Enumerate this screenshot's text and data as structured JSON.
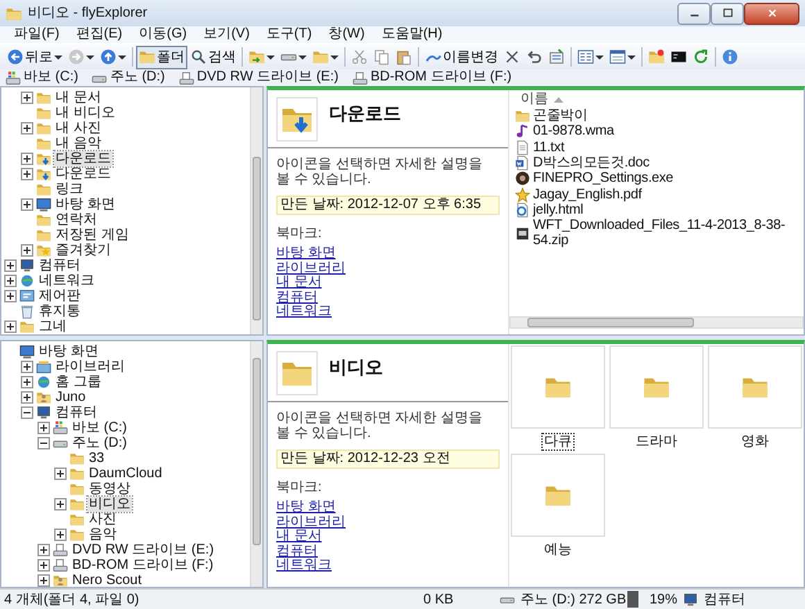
{
  "window": {
    "title": "비디오 - flyExplorer"
  },
  "menu": [
    "파일(F)",
    "편집(E)",
    "이동(G)",
    "보기(V)",
    "도구(T)",
    "창(W)",
    "도움말(H)"
  ],
  "toolbar": [
    {
      "kind": "button",
      "label": "뒤로",
      "dropdown": true,
      "pressed": false
    },
    {
      "kind": "button",
      "dropdown": true,
      "pressed": false
    },
    {
      "kind": "button",
      "dropdown": true,
      "pressed": false
    },
    {
      "kind": "separator"
    },
    {
      "kind": "button",
      "label": "폴더",
      "dropdown": false,
      "pressed": true
    },
    {
      "kind": "button",
      "label": "검색",
      "dropdown": false,
      "pressed": false
    },
    {
      "kind": "separator"
    },
    {
      "kind": "button",
      "dropdown": true,
      "pressed": false
    },
    {
      "kind": "button",
      "dropdown": true,
      "pressed": false
    },
    {
      "kind": "button",
      "dropdown": true,
      "pressed": false
    },
    {
      "kind": "separator"
    },
    {
      "kind": "button",
      "dropdown": false,
      "pressed": false
    },
    {
      "kind": "button",
      "dropdown": false,
      "pressed": false
    },
    {
      "kind": "button",
      "dropdown": false,
      "pressed": false
    },
    {
      "kind": "separator"
    },
    {
      "kind": "button",
      "label": "이름변경",
      "dropdown": false,
      "pressed": false
    },
    {
      "kind": "button",
      "dropdown": false,
      "pressed": false
    },
    {
      "kind": "button",
      "dropdown": false,
      "pressed": false
    },
    {
      "kind": "button",
      "dropdown": false,
      "pressed": false
    },
    {
      "kind": "separator"
    },
    {
      "kind": "button",
      "dropdown": true,
      "pressed": false
    },
    {
      "kind": "button",
      "dropdown": true,
      "pressed": false
    },
    {
      "kind": "separator"
    },
    {
      "kind": "button",
      "dropdown": false,
      "pressed": false
    },
    {
      "kind": "button",
      "dropdown": false,
      "pressed": false
    },
    {
      "kind": "button",
      "dropdown": false,
      "pressed": false
    },
    {
      "kind": "separator"
    },
    {
      "kind": "button",
      "dropdown": false,
      "pressed": false
    }
  ],
  "drives": [
    "바보 (C:)",
    "주노 (D:)",
    "DVD RW 드라이브 (E:)",
    "BD-ROM 드라이브 (F:)"
  ],
  "trees": [
    {
      "items": [
        {
          "children": [
            {
              "label": "내 문서",
              "expandable": true,
              "expanded": false,
              "selected": false
            },
            {
              "label": "내 비디오",
              "expandable": false,
              "selected": false
            },
            {
              "label": "내 사진",
              "expandable": true,
              "expanded": false,
              "selected": false
            },
            {
              "label": "내 음악",
              "expandable": false,
              "selected": false
            },
            {
              "label": "다운로드",
              "expandable": true,
              "expanded": false,
              "selected": true
            },
            {
              "label": "다운로드",
              "expandable": true,
              "expanded": false,
              "selected": false
            },
            {
              "label": "링크",
              "expandable": false,
              "selected": false
            },
            {
              "label": "바탕 화면",
              "expandable": true,
              "expanded": false,
              "selected": false
            },
            {
              "label": "연락처",
              "expandable": false,
              "selected": false
            },
            {
              "label": "저장된 게임",
              "expandable": false,
              "selected": false
            },
            {
              "label": "즐겨찾기",
              "expandable": true,
              "expanded": false,
              "selected": false
            }
          ]
        },
        {
          "label": "컴퓨터",
          "expandable": true,
          "expanded": false,
          "selected": false
        },
        {
          "label": "네트워크",
          "expandable": true,
          "expanded": false,
          "selected": false
        },
        {
          "label": "제어판",
          "expandable": true,
          "expanded": false,
          "selected": false
        },
        {
          "label": "휴지통",
          "expandable": false,
          "selected": false
        },
        {
          "label": "그네",
          "expandable": true,
          "expanded": false,
          "selected": false
        }
      ]
    },
    {
      "items": [
        {
          "label": "바탕 화면",
          "expandable": false,
          "selected": false,
          "children": [
            {
              "label": "라이브러리",
              "expandable": true,
              "expanded": false,
              "selected": false
            },
            {
              "label": "홈 그룹",
              "expandable": true,
              "expanded": false,
              "selected": false
            },
            {
              "label": "Juno",
              "expandable": true,
              "expanded": false,
              "selected": false
            },
            {
              "label": "컴퓨터",
              "expandable": true,
              "expanded": true,
              "selected": false,
              "children": [
                {
                  "label": "바보 (C:)",
                  "expandable": true,
                  "expanded": false,
                  "selected": false
                },
                {
                  "label": "주노 (D:)",
                  "expandable": true,
                  "expanded": true,
                  "selected": false,
                  "children": [
                    {
                      "label": "33",
                      "expandable": false,
                      "selected": false
                    },
                    {
                      "label": "DaumCloud",
                      "expandable": true,
                      "expanded": false,
                      "selected": false
                    },
                    {
                      "label": "동영상",
                      "expandable": false,
                      "selected": false
                    },
                    {
                      "label": "비디오",
                      "expandable": true,
                      "expanded": false,
                      "selected": true
                    },
                    {
                      "label": "사진",
                      "expandable": false,
                      "selected": false
                    },
                    {
                      "label": "음악",
                      "expandable": true,
                      "expanded": false,
                      "selected": false
                    }
                  ]
                },
                {
                  "label": "DVD RW 드라이브 (E:)",
                  "expandable": true,
                  "expanded": false,
                  "selected": false
                },
                {
                  "label": "BD-ROM 드라이브 (F:)",
                  "expandable": true,
                  "expanded": false,
                  "selected": false
                },
                {
                  "label": "Nero Scout",
                  "expandable": true,
                  "expanded": false,
                  "selected": false
                }
              ]
            }
          ]
        }
      ]
    }
  ],
  "panes": [
    {
      "info": {
        "title": "다운로드",
        "description": "아이콘을 선택하면 자세한 설명을 볼 수 있습니다.",
        "created": "만든 날짜: 2012-12-07 오후 6:35",
        "bookmarks_label": "북마크:",
        "bookmarks": [
          "바탕 화면",
          "라이브러리",
          "내 문서",
          "컴퓨터",
          "네트워크"
        ]
      },
      "view": {
        "kind": "details",
        "column": "이름",
        "files": [
          "곤줄박이",
          "01-9878.wma",
          "11.txt",
          "D박스의모든것.doc",
          "FINEPRO_Settings.exe",
          "Jagay_English.pdf",
          "jelly.html",
          "WFT_Downloaded_Files_11-4-2013_8-38-54.zip"
        ]
      }
    },
    {
      "info": {
        "title": "비디오",
        "description": "아이콘을 선택하면 자세한 설명을 볼 수 있습니다.",
        "created": "만든 날짜: 2012-12-23 오전",
        "bookmarks_label": "북마크:",
        "bookmarks": [
          "바탕 화면",
          "라이브러리",
          "내 문서",
          "컴퓨터",
          "네트워크"
        ]
      },
      "view": {
        "kind": "tiles",
        "tiles": [
          {
            "label": "다큐",
            "focused": true
          },
          {
            "label": "드라마",
            "focused": false
          },
          {
            "label": "영화",
            "focused": false
          },
          {
            "label": "예능",
            "focused": false
          }
        ]
      }
    }
  ],
  "status": {
    "summary": "4 개체(폴더 4, 파일 0)",
    "size": "0 KB",
    "drive": "주노 (D:) 272 GB",
    "usage": "19%",
    "location": "컴퓨터"
  }
}
